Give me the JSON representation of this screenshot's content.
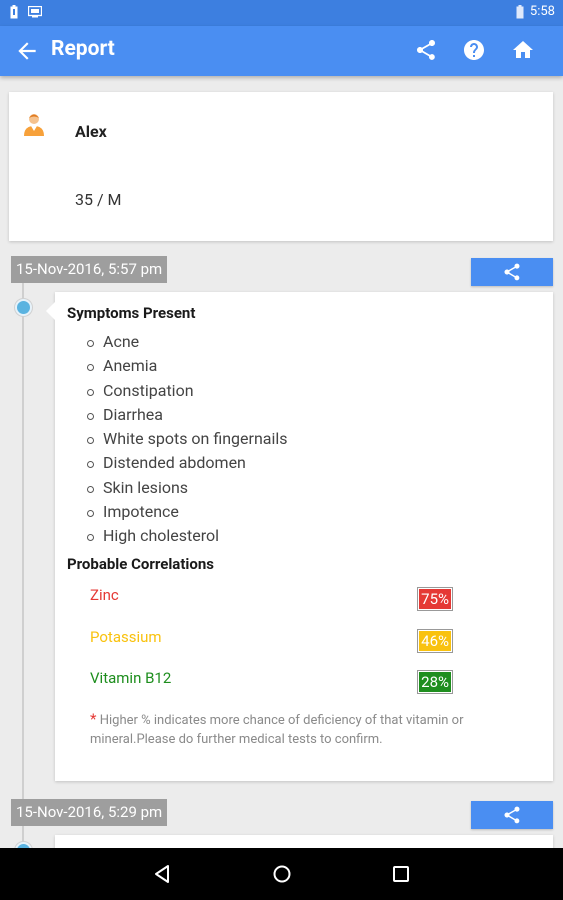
{
  "status_bar": {
    "time": "5:58"
  },
  "app_bar": {
    "title": "Report",
    "actions": [
      "share-icon",
      "help-icon",
      "home-icon"
    ]
  },
  "profile": {
    "name": "Alex",
    "age_sex": "35 / M"
  },
  "reports": [
    {
      "date": "15-Nov-2016, 5:57 pm",
      "symptoms_heading": "Symptoms Present",
      "symptoms": [
        "Acne",
        "Anemia",
        "Constipation",
        "Diarrhea",
        "White spots on fingernails",
        "Distended abdomen",
        "Skin lesions",
        "Impotence",
        "High cholesterol"
      ],
      "correlations_heading": "Probable Correlations",
      "correlations": [
        {
          "name": "Zinc",
          "percent": "75%",
          "color": "#e53935"
        },
        {
          "name": "Potassium",
          "percent": "46%",
          "color": "#f9c20f"
        },
        {
          "name": "Vitamin B12",
          "percent": "28%",
          "color": "#1e8e1e"
        }
      ],
      "note_star": "*",
      "note": "Higher % indicates more chance of deficiency of that vitamin or mineral.Please do further medical tests to confirm."
    },
    {
      "date": "15-Nov-2016, 5:29 pm"
    }
  ],
  "colors": {
    "primary": "#4a8ef2",
    "status_bar": "#3d7fe0",
    "timeline_dot": "#5ab3e0"
  }
}
